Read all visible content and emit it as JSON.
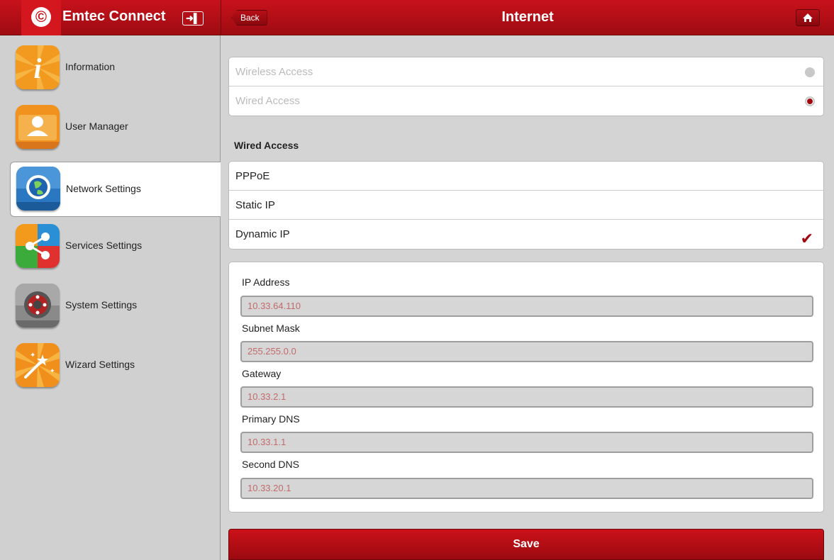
{
  "header": {
    "app_title": "Emtec Connect",
    "back_label": "Back",
    "page_title": "Internet"
  },
  "sidebar": {
    "items": [
      {
        "label": "Information",
        "icon": "info-icon"
      },
      {
        "label": "User Manager",
        "icon": "user-icon"
      },
      {
        "label": "Network Settings",
        "icon": "globe-icon",
        "active": true
      },
      {
        "label": "Services Settings",
        "icon": "share-icon"
      },
      {
        "label": "System Settings",
        "icon": "gear-icon"
      },
      {
        "label": "Wizard Settings",
        "icon": "magic-wand-icon"
      }
    ]
  },
  "access": {
    "options": [
      {
        "label": "Wireless Access",
        "selected": false
      },
      {
        "label": "Wired Access",
        "selected": true
      }
    ]
  },
  "wired": {
    "section_title": "Wired Access",
    "modes": [
      {
        "label": "PPPoE",
        "selected": false
      },
      {
        "label": "Static IP",
        "selected": false
      },
      {
        "label": "Dynamic IP",
        "selected": true
      }
    ]
  },
  "fields": [
    {
      "label": "IP Address",
      "value": "10.33.64.110"
    },
    {
      "label": "Subnet Mask",
      "value": "255.255.0.0"
    },
    {
      "label": "Gateway",
      "value": "10.33.2.1"
    },
    {
      "label": "Primary DNS",
      "value": "10.33.1.1"
    },
    {
      "label": "Second DNS",
      "value": "10.33.20.1"
    }
  ],
  "save_label": "Save",
  "colors": {
    "accent": "#c8121b",
    "check": "#a0080f",
    "field_text": "#c26b6b"
  }
}
